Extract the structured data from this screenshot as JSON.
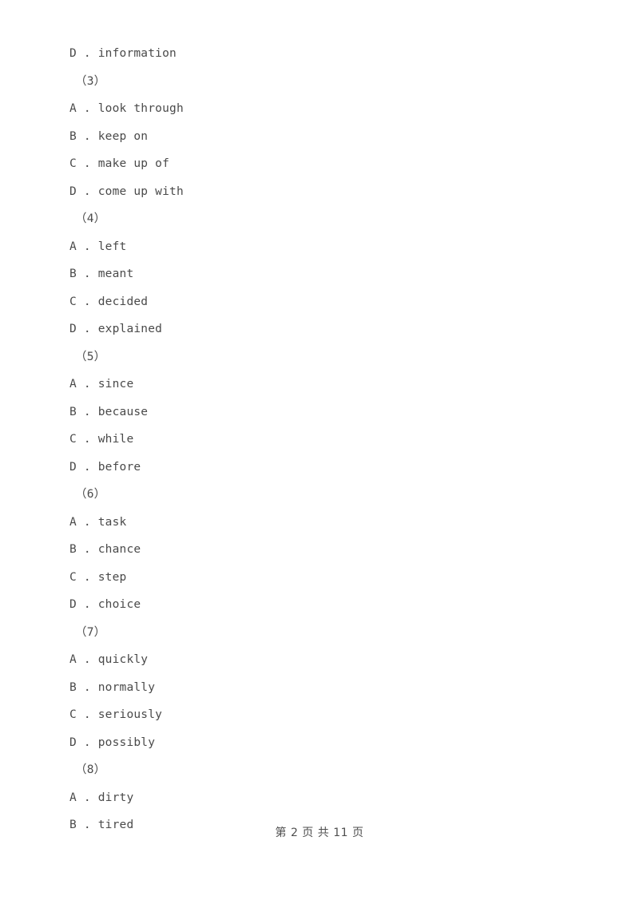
{
  "page": {
    "background_color": "#ffffff",
    "text_color": "#4a4a4a"
  },
  "document": {
    "lines": [
      {
        "kind": "option",
        "text": "D . information"
      },
      {
        "kind": "qnum",
        "text": "（3）"
      },
      {
        "kind": "option",
        "text": "A . look through"
      },
      {
        "kind": "option",
        "text": "B . keep on"
      },
      {
        "kind": "option",
        "text": "C . make up of"
      },
      {
        "kind": "option",
        "text": "D . come up with"
      },
      {
        "kind": "qnum",
        "text": "（4）"
      },
      {
        "kind": "option",
        "text": "A . left"
      },
      {
        "kind": "option",
        "text": "B . meant"
      },
      {
        "kind": "option",
        "text": "C . decided"
      },
      {
        "kind": "option",
        "text": "D . explained"
      },
      {
        "kind": "qnum",
        "text": "（5）"
      },
      {
        "kind": "option",
        "text": "A . since"
      },
      {
        "kind": "option",
        "text": "B . because"
      },
      {
        "kind": "option",
        "text": "C . while"
      },
      {
        "kind": "option",
        "text": "D . before"
      },
      {
        "kind": "qnum",
        "text": "（6）"
      },
      {
        "kind": "option",
        "text": "A . task"
      },
      {
        "kind": "option",
        "text": "B . chance"
      },
      {
        "kind": "option",
        "text": "C . step"
      },
      {
        "kind": "option",
        "text": "D . choice"
      },
      {
        "kind": "qnum",
        "text": "（7）"
      },
      {
        "kind": "option",
        "text": "A . quickly"
      },
      {
        "kind": "option",
        "text": "B . normally"
      },
      {
        "kind": "option",
        "text": "C . seriously"
      },
      {
        "kind": "option",
        "text": "D . possibly"
      },
      {
        "kind": "qnum",
        "text": "（8）"
      },
      {
        "kind": "option",
        "text": "A . dirty"
      },
      {
        "kind": "option",
        "text": "B . tired"
      }
    ]
  },
  "footer": {
    "text": "第 2 页 共 11 页",
    "current_page": "2",
    "total_pages": "11"
  }
}
